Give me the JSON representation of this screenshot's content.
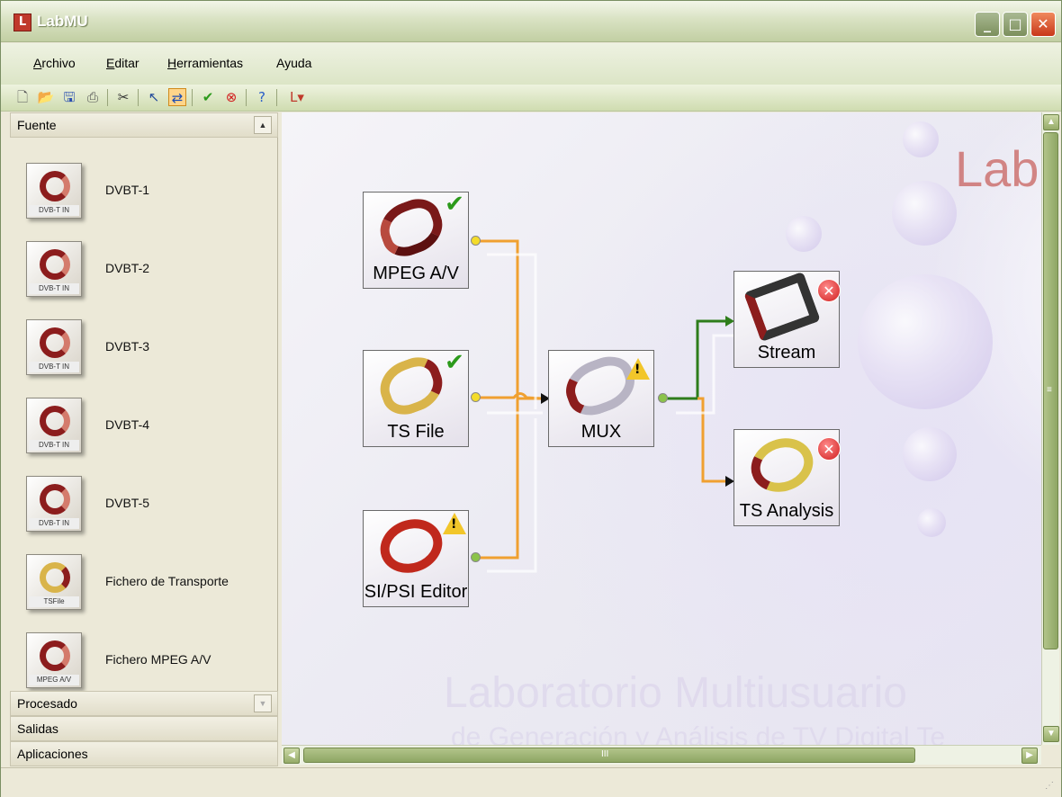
{
  "window": {
    "title": "LabMU",
    "controls": {
      "minimize": "_",
      "maximize": "□",
      "close": "✕"
    }
  },
  "menu": {
    "items": [
      {
        "label_ul": "A",
        "label_rest": "rchivo"
      },
      {
        "label_ul": "E",
        "label_rest": "ditar"
      },
      {
        "label_ul": "H",
        "label_rest": "erramientas"
      },
      {
        "label_ul": "",
        "label_rest": "Ayuda"
      }
    ]
  },
  "toolbar": {
    "icons": [
      "new-file-icon",
      "open-folder-icon",
      "save-icon",
      "print-icon",
      "cut-icon",
      "pointer-icon",
      "connect-icon",
      "validate-icon",
      "stop-icon",
      "help-icon",
      "app-menu-icon"
    ]
  },
  "panel": {
    "sections": {
      "fuente": "Fuente",
      "procesado": "Procesado",
      "salidas": "Salidas",
      "aplicaciones": "Aplicaciones"
    },
    "sources": [
      {
        "label": "DVBT-1",
        "tag": "DVB-T IN"
      },
      {
        "label": "DVBT-2",
        "tag": "DVB-T IN"
      },
      {
        "label": "DVBT-3",
        "tag": "DVB-T IN"
      },
      {
        "label": "DVBT-4",
        "tag": "DVB-T IN"
      },
      {
        "label": "DVBT-5",
        "tag": "DVB-T IN"
      },
      {
        "label": "Fichero de Transporte",
        "tag": "TSFile"
      },
      {
        "label": "Fichero MPEG A/V",
        "tag": "MPEG A/V"
      }
    ]
  },
  "canvas": {
    "logo_text": "Lab",
    "watermark_line1": "Laboratorio Multiusuario",
    "watermark_line2": "de Generación y Análisis de TV Digital Te",
    "nodes": {
      "mpeg": {
        "label": "MPEG A/V",
        "status": "ok"
      },
      "tsfile": {
        "label": "TS File",
        "status": "ok"
      },
      "sipsi": {
        "label": "SI/PSI Editor",
        "status": "warning"
      },
      "mux": {
        "label": "MUX",
        "status": "warning"
      },
      "stream": {
        "label": "Stream",
        "status": "error"
      },
      "tsanalysis": {
        "label": "TS Analysis",
        "status": "error"
      }
    },
    "colors": {
      "connector_orange": "#f0a030",
      "connector_green": "#2e7d1b",
      "port_yellow": "#f4dc2a",
      "port_green": "#8bc34a"
    }
  },
  "scroll": {
    "h_grip": "III",
    "v_grip": "≡"
  }
}
